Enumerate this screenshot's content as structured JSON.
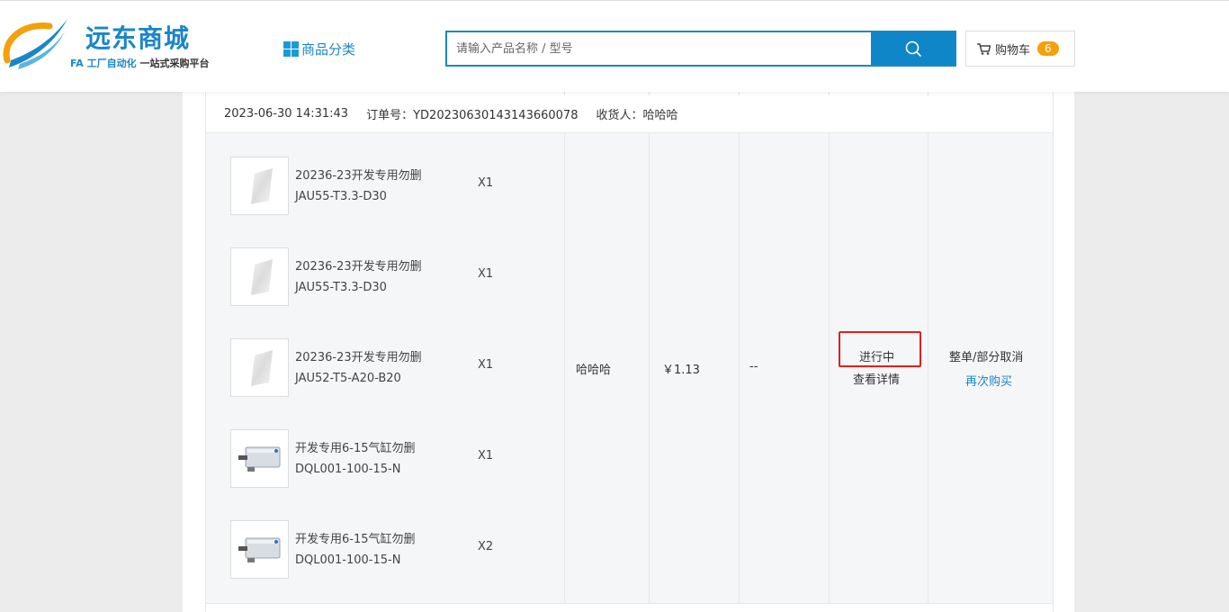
{
  "header": {
    "logo_title": "远东商城",
    "logo_sub_fa": "FA 工厂自动化",
    "logo_sub_rest": "一站式采购平台",
    "category_label": "商品分类",
    "search_placeholder": "请输入产品名称 / 型号",
    "cart_label": "购物车",
    "cart_count": "6"
  },
  "order": {
    "date": "2023-06-30 14:31:43",
    "order_no_label": "订单号：",
    "order_no": "YD20230630143143660078",
    "receiver_label": "收货人：",
    "receiver": "哈哈哈",
    "items": [
      {
        "name_line1": "20236-23开发专用勿删",
        "name_line2": "JAU55-T3.3-D30",
        "qty": "X1",
        "thumb": "plate-icon"
      },
      {
        "name_line1": "20236-23开发专用勿删",
        "name_line2": "JAU55-T3.3-D30",
        "qty": "X1",
        "thumb": "plate-icon"
      },
      {
        "name_line1": "20236-23开发专用勿删",
        "name_line2": "JAU52-T5-A20-B20",
        "qty": "X1",
        "thumb": "plate-icon"
      },
      {
        "name_line1": "开发专用6-15气缸勿删",
        "name_line2": "DQL001-100-15-N",
        "qty": "X1",
        "thumb": "cylinder-icon"
      },
      {
        "name_line1": "开发专用6-15气缸勿删",
        "name_line2": "DQL001-100-15-N",
        "qty": "X2",
        "thumb": "cylinder-icon"
      }
    ],
    "consignee": "哈哈哈",
    "amount": "￥1.13",
    "extra": "--",
    "status": "进行中",
    "view_detail": "查看详情",
    "cancel": "整单/部分取消",
    "rebuy": "再次购买"
  },
  "colors": {
    "brand": "#1a86c8",
    "badge": "#f4a00b",
    "highlight": "#e02020"
  }
}
